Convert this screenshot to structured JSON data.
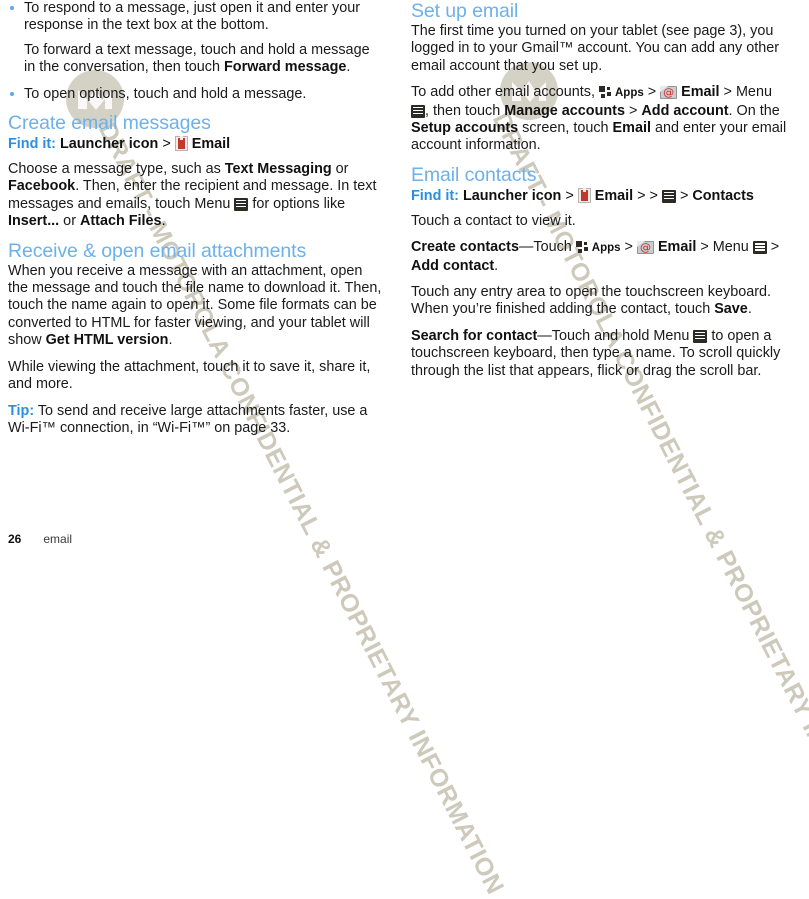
{
  "document": {
    "footer": {
      "page_number": "26",
      "section": "email"
    },
    "watermark": {
      "text": "DRAFT - MOTOROLA CONFIDENTIAL & PROPRIETARY INFORMATION",
      "logo": "motorola-batwing-logo"
    },
    "colors": {
      "heading": "#6cb1ec",
      "accent": "#2a8fe0",
      "bullet": "#5aa9e8",
      "body": "#1a1a1a",
      "watermark": "#cdc9bb"
    }
  },
  "icons": {
    "menu": "menu-icon",
    "launcher": "launcher-icon",
    "email": "email-app-icon",
    "apps": "apps-icon",
    "apps_label": "Apps"
  },
  "left_column": {
    "bullets": [
      {
        "text": "To respond to a message, just open it and enter your response in the text box at the bottom."
      },
      {
        "text": "To open options, touch and hold a message."
      }
    ],
    "sub_paragraph": {
      "pre": "To forward a text message, touch and hold a message in the conversation, then touch ",
      "bold": "Forward message",
      "post": "."
    },
    "sections": [
      {
        "heading": "Create email messages",
        "findit": {
          "label": "Find it:",
          "part1": "Launcher icon",
          "sep1": ">",
          "part2": "Email"
        },
        "paragraphs": [
          {
            "runs": [
              {
                "t": "Choose a message type, such as ",
                "b": false
              },
              {
                "t": "Text Messaging",
                "b": true
              },
              {
                "t": " or ",
                "b": false
              },
              {
                "t": "Facebook",
                "b": true
              },
              {
                "t": ". Then, enter the recipient and message. In text messages and emails, touch Menu ",
                "b": false
              },
              {
                "t": "[menu-icon]",
                "b": false
              },
              {
                "t": " for options like ",
                "b": false
              },
              {
                "t": "Insert...",
                "b": true
              },
              {
                "t": " or ",
                "b": false
              },
              {
                "t": "Attach Files",
                "b": true
              },
              {
                "t": ".",
                "b": false
              }
            ]
          }
        ]
      },
      {
        "heading": "Receive & open email attachments",
        "paragraphs": [
          {
            "runs": [
              {
                "t": "When you receive a message with an attachment, open the message and touch the file name to download it. Then, touch the name again to open it. Some file formats can be converted to HTML for faster viewing, and your tablet will show ",
                "b": false
              },
              {
                "t": "Get HTML version",
                "b": true
              },
              {
                "t": ".",
                "b": false
              }
            ]
          },
          {
            "runs": [
              {
                "t": "While viewing the attachment, touch it to save it, share it, and more.",
                "b": false
              }
            ]
          },
          {
            "tip_label": "Tip:",
            "runs": [
              {
                "t": " To send and receive large attachments faster, use a Wi-Fi™ connection, in “Wi-Fi™” on page 33.",
                "b": false
              }
            ]
          }
        ]
      }
    ]
  },
  "right_column": {
    "sections": [
      {
        "heading": "Set up email",
        "paragraphs": [
          {
            "runs": [
              {
                "t": "The first time you turned on your tablet (see page 3), you logged in to your Gmail™ account. You can add any other email account that you set up.",
                "b": false
              }
            ]
          },
          {
            "runs": [
              {
                "t": "To add other email accounts, ",
                "b": false
              },
              {
                "t": "[apps-icon] Apps",
                "b": true
              },
              {
                "t": " > ",
                "b": false
              },
              {
                "t": "[email-icon] Email",
                "b": true
              },
              {
                "t": " > Menu [menu-icon], then touch ",
                "b": false
              },
              {
                "t": "Manage accounts",
                "b": true
              },
              {
                "t": " > ",
                "b": false
              },
              {
                "t": "Add account",
                "b": true
              },
              {
                "t": ". On the ",
                "b": false
              },
              {
                "t": "Setup accounts",
                "b": true
              },
              {
                "t": " screen, touch ",
                "b": false
              },
              {
                "t": "Email",
                "b": true
              },
              {
                "t": " and enter your email account information.",
                "b": false
              }
            ]
          }
        ]
      },
      {
        "heading": "Email contacts",
        "findit": {
          "label": "Find it:",
          "part1": "Launcher icon",
          "sep1": ">",
          "part2": "Email",
          "sep2": ">",
          "sep3": ">",
          "part3": "Contacts"
        },
        "paragraphs": [
          {
            "runs": [
              {
                "t": "Touch a contact to view it.",
                "b": false
              }
            ]
          },
          {
            "runs": [
              {
                "t": "Create contacts",
                "b": true
              },
              {
                "t": "—Touch ",
                "b": false
              },
              {
                "t": "[apps-icon] Apps",
                "b": true
              },
              {
                "t": " > ",
                "b": false
              },
              {
                "t": "[email-icon] Email",
                "b": true
              },
              {
                "t": " > Menu [menu-icon] > ",
                "b": false
              },
              {
                "t": "Add contact",
                "b": true
              },
              {
                "t": ".",
                "b": false
              }
            ]
          },
          {
            "runs": [
              {
                "t": "Touch any entry area to open the touchscreen keyboard. When you’re finished adding the contact, touch ",
                "b": false
              },
              {
                "t": "Save",
                "b": true
              },
              {
                "t": ".",
                "b": false
              }
            ]
          },
          {
            "runs": [
              {
                "t": "Search for contact",
                "b": true
              },
              {
                "t": "—Touch and hold Menu [menu-icon] to open a touchscreen keyboard, then type a name. To scroll quickly through the list that appears, flick or drag the scroll bar.",
                "b": false
              }
            ]
          }
        ]
      }
    ]
  },
  "text": {
    "l_b1": "To respond to a message, just open it and enter your response in the text box at the bottom.",
    "l_sub_pre": "To forward a text message, touch and hold a message in the conversation, then touch ",
    "l_sub_bold": "Forward message",
    "l_sub_post": ".",
    "l_b2": "To open options, touch and hold a message.",
    "h_create": "Create email messages",
    "findit_label": "Find it:",
    "launcher_icon_label": "Launcher icon",
    "email_label": "Email",
    "gt": ">",
    "p_choose_1": "Choose a message type, such as ",
    "p_choose_b1": "Text Messaging",
    "p_choose_2": " or ",
    "p_choose_b2": "Facebook",
    "p_choose_3": ". Then, enter the recipient and message. In text messages and emails, touch Menu ",
    "p_choose_4": " for options like ",
    "p_choose_b3": "Insert...",
    "p_choose_5": " or ",
    "p_choose_b4": "Attach Files",
    "p_choose_6": ".",
    "h_receive": "Receive & open email attachments",
    "p_recv_1": "When you receive a message with an attachment, open the message and touch the file name to download it. Then, touch the name again to open it. Some file formats can be converted to HTML for faster viewing, and your tablet will show ",
    "p_recv_b1": "Get HTML version",
    "p_recv_2": ".",
    "p_while": "While viewing the attachment, touch it to save it, share it, and more.",
    "tip_label": "Tip:",
    "p_tip": " To send and receive large attachments faster, use a Wi-Fi™ connection, in “Wi-Fi™” on page 33.",
    "h_setup": "Set up email",
    "p_setup_1": "The first time you turned on your tablet (see page 3), you logged in to your Gmail™ account. You can add any other email account that you set up.",
    "p_add_1": "To add other email accounts, ",
    "apps_label": "Apps",
    "p_add_2": " > ",
    "p_add_3": " > Menu ",
    "p_add_4": ", then touch ",
    "p_add_b1": "Manage accounts",
    "p_add_5": " > ",
    "p_add_b2": "Add account",
    "p_add_6": ". On the ",
    "p_add_b3": "Setup accounts",
    "p_add_7": " screen, touch ",
    "p_add_b4": "Email",
    "p_add_8": " and enter your email account information.",
    "h_contacts": "Email contacts",
    "contacts_label": "Contacts",
    "p_touch_contact": "Touch a contact to view it.",
    "p_create_b": "Create contacts",
    "p_create_1": "—Touch ",
    "p_create_2": " > ",
    "p_create_3": " > Menu ",
    "p_create_4": " > ",
    "p_create_b2": "Add contact",
    "p_create_5": ".",
    "p_entry_1": "Touch any entry area to open the touchscreen keyboard. When you’re finished adding the contact, touch ",
    "p_entry_b": "Save",
    "p_entry_2": ".",
    "p_search_b": "Search for contact",
    "p_search_1": "—Touch and hold Menu ",
    "p_search_2": " to open a touchscreen keyboard, then type a name. To scroll quickly through the list that appears, flick or drag the scroll bar.",
    "footer_page": "26",
    "footer_section": "email",
    "watermark": "DRAFT - MOTOROLA CONFIDENTIAL & PROPRIETARY INFORMATION"
  }
}
